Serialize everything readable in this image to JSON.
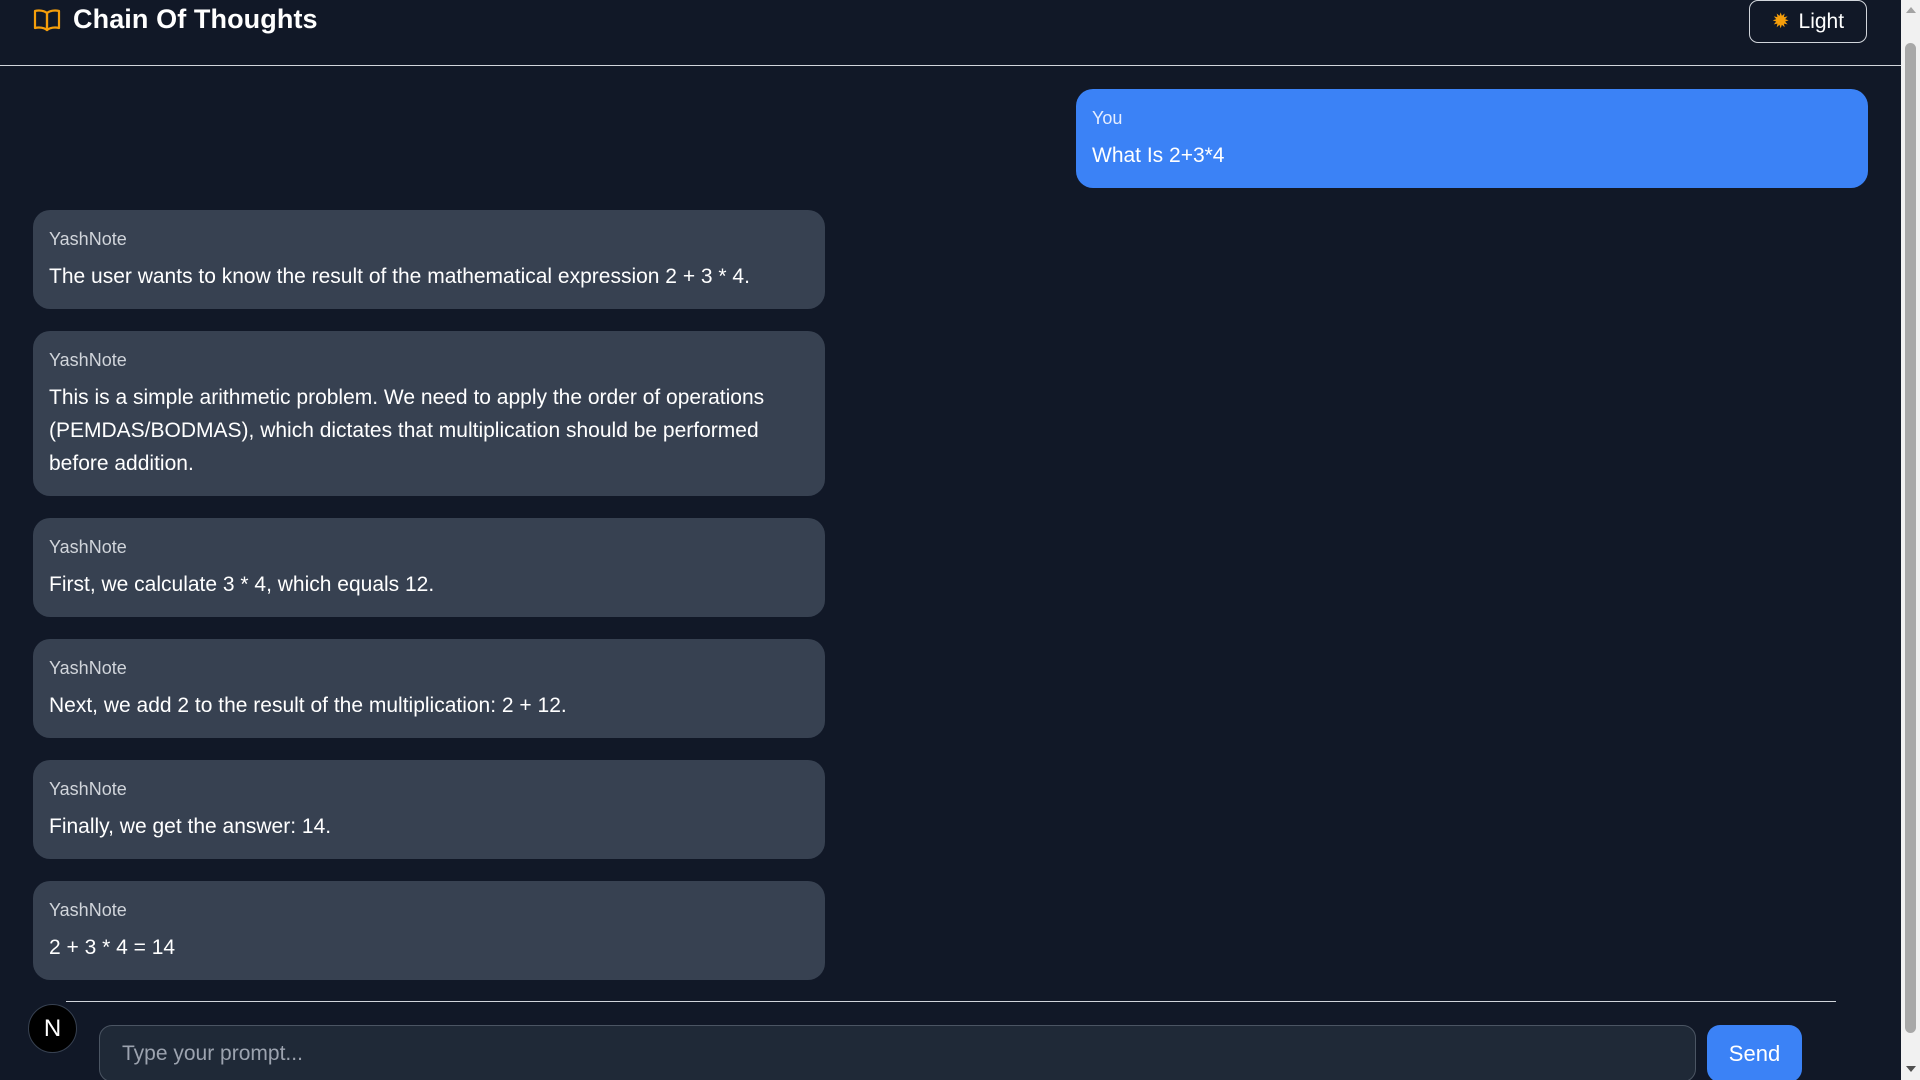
{
  "header": {
    "title": "Chain Of Thoughts",
    "brand_icon": "book-open-icon",
    "theme_toggle": {
      "label": "Light",
      "icon": "sun-icon"
    }
  },
  "messages": [
    {
      "role": "user",
      "sender": "You",
      "text": "What Is 2+3*4"
    },
    {
      "role": "assistant",
      "sender": "YashNote",
      "text": "The user wants to know the result of the mathematical expression 2 + 3 * 4."
    },
    {
      "role": "assistant",
      "sender": "YashNote",
      "text": "This is a simple arithmetic problem. We need to apply the order of operations (PEMDAS/BODMAS), which dictates that multiplication should be performed before addition."
    },
    {
      "role": "assistant",
      "sender": "YashNote",
      "text": "First, we calculate 3 * 4, which equals 12."
    },
    {
      "role": "assistant",
      "sender": "YashNote",
      "text": "Next, we add 2 to the result of the multiplication: 2 + 12."
    },
    {
      "role": "assistant",
      "sender": "YashNote",
      "text": "Finally, we get the answer: 14."
    },
    {
      "role": "assistant",
      "sender": "YashNote",
      "text": "2 + 3 * 4 = 14"
    }
  ],
  "composer": {
    "avatar_letter": "N",
    "placeholder": "Type your prompt...",
    "value": "",
    "send_label": "Send"
  },
  "colors": {
    "background": "#111827",
    "user_bubble": "#3b82f6",
    "assistant_bubble": "#374151",
    "accent": "#f59e0b"
  }
}
